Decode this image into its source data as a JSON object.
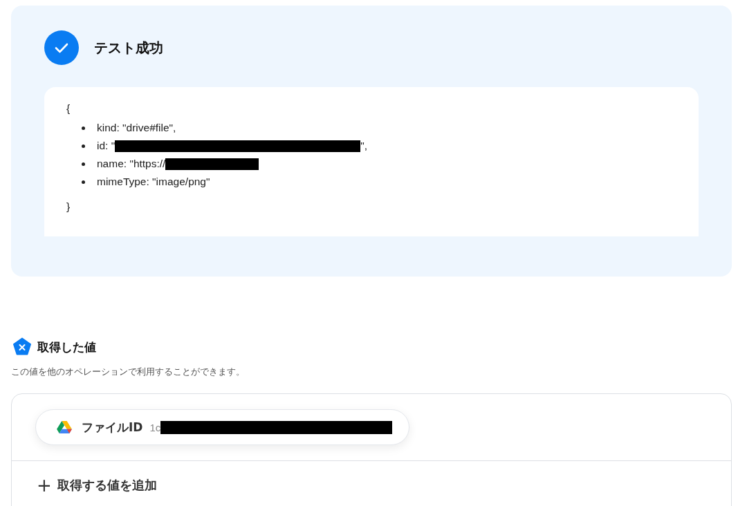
{
  "result": {
    "title": "テスト成功",
    "open_brace": "{",
    "close_brace": "}",
    "fields": [
      {
        "text": "kind: \"drive#file\",",
        "redacted": false
      },
      {
        "text": "id: \"",
        "redacted": true,
        "after": "\","
      },
      {
        "text": "name: \"https://",
        "redacted": true
      },
      {
        "text": "mimeType: \"image/png\"",
        "redacted": false
      }
    ]
  },
  "values": {
    "title": "取得した値",
    "description": "この値を他のオペレーションで利用することができます。",
    "items": [
      {
        "label": "ファイルID",
        "value": "1c",
        "redacted": true
      }
    ],
    "add_button": {
      "icon": "+",
      "label": "取得する値を追加"
    }
  }
}
